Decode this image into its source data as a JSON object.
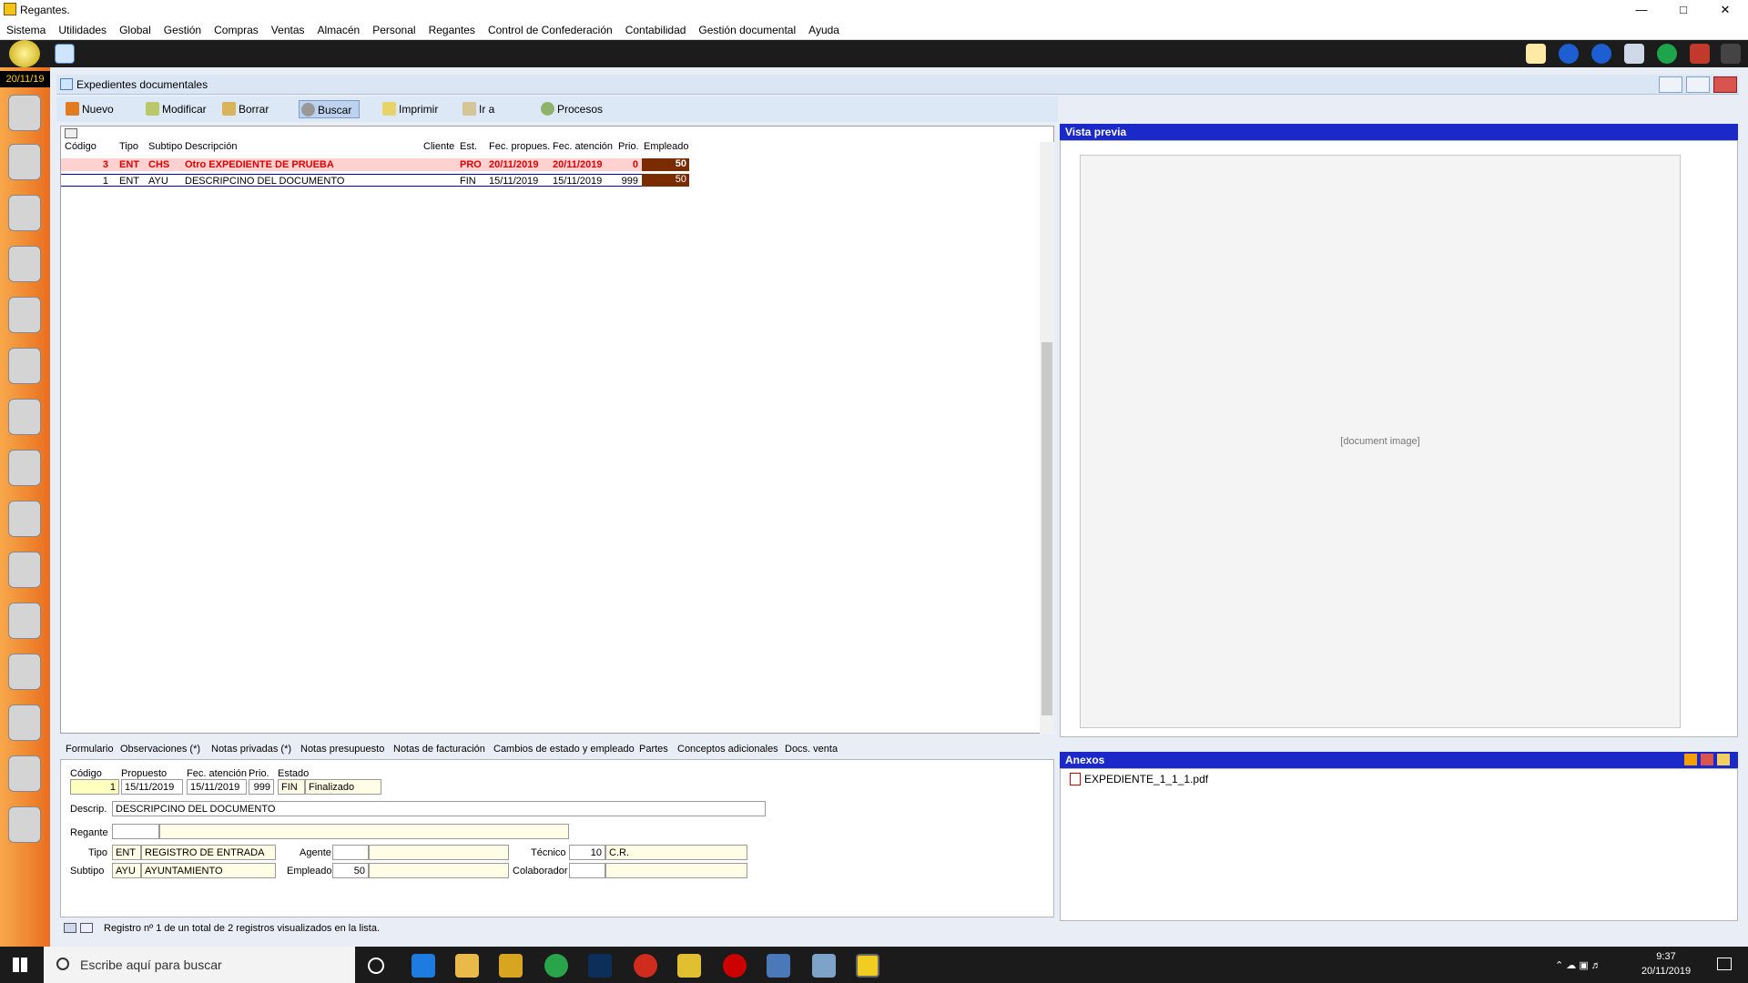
{
  "window": {
    "title": "Regantes."
  },
  "menu": [
    "Sistema",
    "Utilidades",
    "Global",
    "Gestión",
    "Compras",
    "Ventas",
    "Almacén",
    "Personal",
    "Regantes",
    "Control de Confederación",
    "Contabilidad",
    "Gestión documental",
    "Ayuda"
  ],
  "sidebar": {
    "date": "20/11/19"
  },
  "child": {
    "title": "Expedientes documentales"
  },
  "toolbar": [
    "Nuevo",
    "Modificar",
    "Borrar",
    "Buscar",
    "Imprimir",
    "Ir a",
    "Procesos"
  ],
  "grid": {
    "headers": [
      "Código",
      "Tipo",
      "Subtipo",
      "Descripción",
      "Cliente",
      "Est.",
      "Fec. propues.",
      "Fec. atención",
      "Prio.",
      "Empleado"
    ],
    "rows": [
      [
        "3",
        "ENT",
        "CHS",
        "Otro EXPEDIENTE DE PRUEBA",
        "",
        "PRO",
        "20/11/2019",
        "20/11/2019",
        "0",
        "50"
      ],
      [
        "1",
        "ENT",
        "AYU",
        "DESCRIPCINO DEL DOCUMENTO",
        "",
        "FIN",
        "15/11/2019",
        "15/11/2019",
        "999",
        "50"
      ]
    ]
  },
  "tabs": [
    "Formulario",
    "Observaciones (*)",
    "Notas privadas (*)",
    "Notas presupuesto",
    "Notas de facturación",
    "Cambios de estado y empleado",
    "Partes",
    "Conceptos adicionales",
    "Docs. venta"
  ],
  "form": {
    "labels": {
      "codigo": "Código",
      "propuesto": "Propuesto",
      "fec_atencion": "Fec. atención",
      "prio": "Prio.",
      "estado": "Estado",
      "descrip": "Descrip.",
      "regante": "Regante",
      "tipo": "Tipo",
      "subtipo": "Subtipo",
      "agente": "Agente",
      "empleado": "Empleado",
      "tecnico": "Técnico",
      "colaborador": "Colaborador"
    },
    "codigo": "1",
    "propuesto": "15/11/2019",
    "fec_atencion": "15/11/2019",
    "prio": "999",
    "estado_code": "FIN",
    "estado_name": "Finalizado",
    "descrip": "DESCRIPCINO DEL DOCUMENTO",
    "tipo_code": "ENT",
    "tipo_name": "REGISTRO DE ENTRADA",
    "subtipo_code": "AYU",
    "subtipo_name": "AYUNTAMIENTO",
    "empleado": "50",
    "tecnico_code": "10",
    "tecnico_name": "C.R."
  },
  "status": {
    "text": "Registro nº 1 de un total de 2 registros visualizados en la lista."
  },
  "preview": {
    "title": "Vista previa"
  },
  "anexos": {
    "title": "Anexos",
    "file": "EXPEDIENTE_1_1_1.pdf"
  },
  "taskbar": {
    "search_placeholder": "Escribe aquí para buscar",
    "time": "9:37",
    "date": "20/11/2019"
  }
}
